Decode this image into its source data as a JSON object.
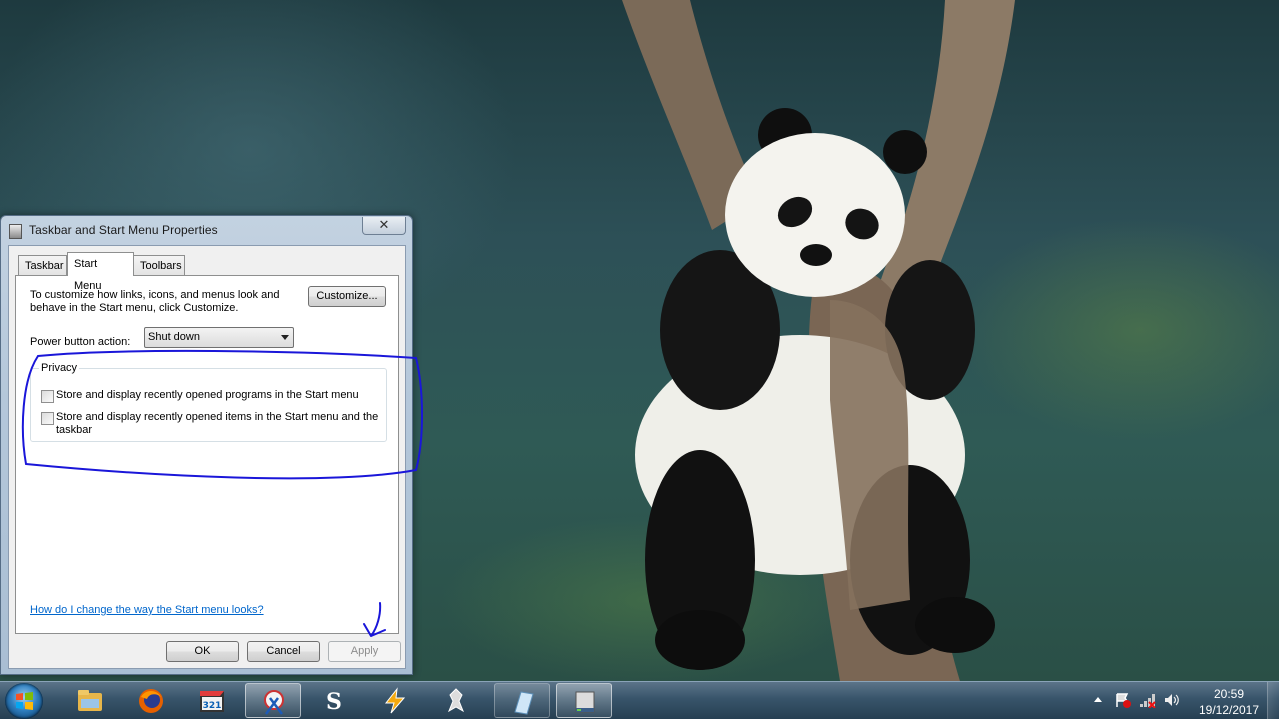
{
  "dialog": {
    "title": "Taskbar and Start Menu Properties",
    "close_glyph": "✕",
    "tabs": [
      {
        "label": "Taskbar"
      },
      {
        "label": "Start Menu",
        "selected": true
      },
      {
        "label": "Toolbars"
      }
    ],
    "description": "To customize how links, icons, and menus look and behave in the Start menu, click Customize.",
    "customize_label": "Customize...",
    "power_button_label": "Power button action:",
    "power_button_value": "Shut down",
    "privacy": {
      "legend": "Privacy",
      "options": [
        {
          "label": "Store and display recently opened programs in the Start menu",
          "checked": false
        },
        {
          "label": "Store and display recently opened items in the Start menu and the taskbar",
          "checked": false
        }
      ]
    },
    "help_link": "How do I change the way the Start menu looks?",
    "ok_label": "OK",
    "cancel_label": "Cancel",
    "apply_label": "Apply",
    "apply_enabled": false
  },
  "taskbar": {
    "pinned": [
      {
        "icon": "file-explorer-icon"
      },
      {
        "icon": "firefox-icon"
      },
      {
        "icon": "media-player-classic-icon"
      },
      {
        "icon": "snipping-tool-icon",
        "state": "active"
      },
      {
        "icon": "steam-icon"
      },
      {
        "icon": "winamp-icon"
      },
      {
        "icon": "skyrim-icon"
      },
      {
        "icon": "notepad-icon",
        "state": "open"
      },
      {
        "icon": "taskbar-properties-icon",
        "state": "active"
      }
    ],
    "tray": {
      "icons": [
        "show-hidden-icons-icon",
        "action-center-icon",
        "network-icon",
        "volume-icon"
      ],
      "time": "20:59",
      "date": "19/12/2017"
    }
  },
  "colors": {
    "annotation": "#1a16d9",
    "link": "#0066cc"
  }
}
